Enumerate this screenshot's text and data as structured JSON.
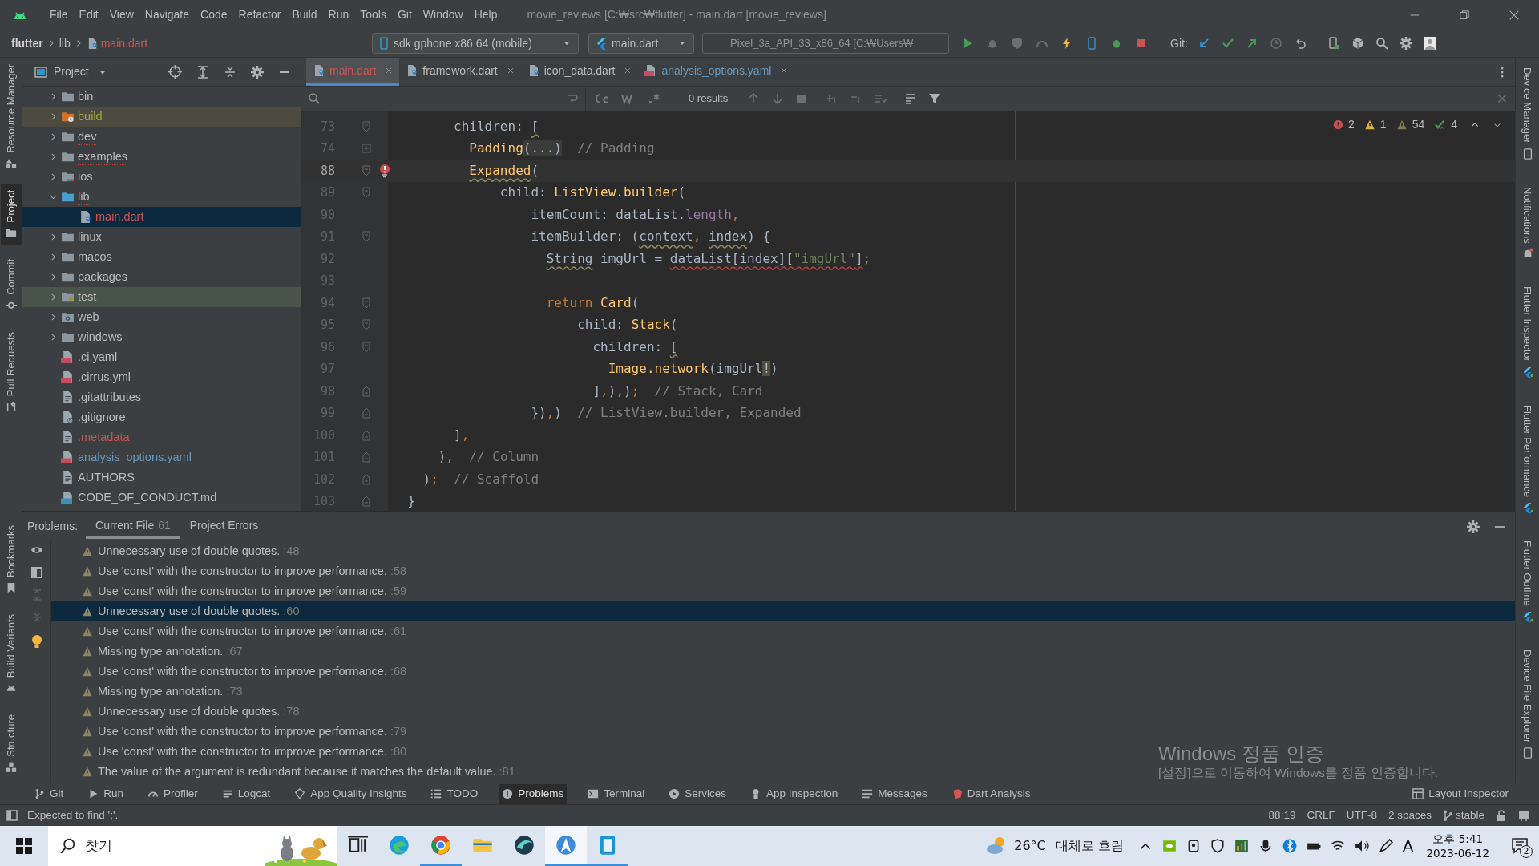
{
  "window": {
    "title": "movie_reviews [C:₩src₩flutter] - main.dart [movie_reviews]"
  },
  "menu": [
    "File",
    "Edit",
    "View",
    "Navigate",
    "Code",
    "Refactor",
    "Build",
    "Run",
    "Tools",
    "Git",
    "Window",
    "Help"
  ],
  "breadcrumbs": [
    {
      "label": "flutter",
      "kind": "project"
    },
    {
      "label": "lib",
      "kind": "folder"
    },
    {
      "label": "main.dart",
      "kind": "dart-file"
    }
  ],
  "run_toolbar": {
    "device": "sdk gphone x86 64 (mobile)",
    "configuration": "main.dart",
    "emulator": "Pixel_3a_API_33_x86_64 [C:₩Users₩",
    "git_label": "Git:"
  },
  "left_strip": [
    {
      "label": "Resource Manager",
      "kind": "resources",
      "selected": false
    },
    {
      "label": "Project",
      "kind": "project",
      "selected": true
    },
    {
      "label": "Commit",
      "kind": "commit",
      "selected": false
    },
    {
      "label": "Pull Requests",
      "kind": "pull",
      "selected": false
    }
  ],
  "left_strip_bottom": [
    {
      "label": "Bookmarks",
      "kind": "bookmark",
      "selected": false
    },
    {
      "label": "Build Variants",
      "kind": "android",
      "selected": false
    },
    {
      "label": "Structure",
      "kind": "structure",
      "selected": false
    }
  ],
  "right_strip": [
    {
      "label": "Device Manager",
      "kind": "device"
    },
    {
      "label": "Notifications",
      "kind": "bell"
    },
    {
      "label": "Flutter Inspector",
      "kind": "flutter"
    },
    {
      "label": "Flutter Performance",
      "kind": "flutter"
    },
    {
      "label": "Flutter Outline",
      "kind": "flutter"
    },
    {
      "label": "Device File Explorer",
      "kind": "device"
    }
  ],
  "project_panel": {
    "title": "Project",
    "tree": [
      {
        "label": "bin",
        "kind": "folder",
        "expanded": false,
        "selected": false,
        "has_errors": false,
        "color": "#bbbbbb"
      },
      {
        "label": "build",
        "kind": "build-folder",
        "expanded": false,
        "selected": false,
        "has_errors": false,
        "color": "#a8a840"
      },
      {
        "label": "dev",
        "kind": "folder",
        "expanded": false,
        "selected": false,
        "has_errors": true,
        "color": "#bbbbbb"
      },
      {
        "label": "examples",
        "kind": "folder",
        "expanded": false,
        "selected": false,
        "has_errors": true,
        "color": "#bbbbbb"
      },
      {
        "label": "ios",
        "kind": "ios-folder",
        "expanded": false,
        "selected": false,
        "has_errors": false,
        "color": "#bbbbbb"
      },
      {
        "label": "lib",
        "kind": "source-folder",
        "expanded": true,
        "selected": false,
        "has_errors": true,
        "color": "#bbbbbb",
        "children": [
          {
            "label": "main.dart",
            "kind": "dart-file",
            "selected": true,
            "has_errors": true,
            "color": "#d25252"
          }
        ]
      },
      {
        "label": "linux",
        "kind": "folder",
        "expanded": false,
        "selected": false,
        "has_errors": false,
        "color": "#bbbbbb"
      },
      {
        "label": "macos",
        "kind": "folder",
        "expanded": false,
        "selected": false,
        "has_errors": false,
        "color": "#bbbbbb"
      },
      {
        "label": "packages",
        "kind": "folder",
        "expanded": false,
        "selected": false,
        "has_errors": true,
        "color": "#bbbbbb"
      },
      {
        "label": "test",
        "kind": "test-folder",
        "expanded": false,
        "selected": false,
        "has_errors": false,
        "color": "#bbbbbb"
      },
      {
        "label": "web",
        "kind": "web-folder",
        "expanded": false,
        "selected": false,
        "has_errors": false,
        "color": "#bbbbbb"
      },
      {
        "label": "windows",
        "kind": "folder",
        "expanded": false,
        "selected": false,
        "has_errors": false,
        "color": "#bbbbbb"
      },
      {
        "label": ".ci.yaml",
        "kind": "yaml-file",
        "selected": false,
        "has_errors": false,
        "color": "#bbbbbb"
      },
      {
        "label": ".cirrus.yml",
        "kind": "yaml-file",
        "selected": false,
        "has_errors": false,
        "color": "#bbbbbb"
      },
      {
        "label": ".gitattributes",
        "kind": "text-file",
        "selected": false,
        "has_errors": false,
        "color": "#bbbbbb"
      },
      {
        "label": ".gitignore",
        "kind": "ignore-file",
        "selected": false,
        "has_errors": false,
        "color": "#bbbbbb"
      },
      {
        "label": ".metadata",
        "kind": "text-file",
        "selected": false,
        "has_errors": false,
        "color": "#c75450"
      },
      {
        "label": "analysis_options.yaml",
        "kind": "yaml-file",
        "selected": false,
        "has_errors": false,
        "color": "#6897bb"
      },
      {
        "label": "AUTHORS",
        "kind": "text-file",
        "selected": false,
        "has_errors": false,
        "color": "#bbbbbb"
      },
      {
        "label": "CODE_OF_CONDUCT.md",
        "kind": "md-file",
        "selected": false,
        "has_errors": false,
        "color": "#bbbbbb"
      }
    ]
  },
  "editor_tabs": [
    {
      "label": "main.dart",
      "kind": "dart-file",
      "selected": true,
      "color": "#d25252"
    },
    {
      "label": "framework.dart",
      "kind": "dart-file",
      "selected": false,
      "color": "#bbbbbb"
    },
    {
      "label": "icon_data.dart",
      "kind": "dart-file",
      "selected": false,
      "color": "#bbbbbb"
    },
    {
      "label": "analysis_options.yaml",
      "kind": "yaml-file",
      "selected": false,
      "color": "#6897bb"
    }
  ],
  "search_bar": {
    "result": "0 results"
  },
  "inspections": {
    "errors": "2",
    "warnings": "1",
    "weak_warnings": "54",
    "typos": "4"
  },
  "code_lines": [
    {
      "number": "73",
      "kind": "fold-start",
      "current": false,
      "error_marker": false,
      "tokens": [
        {
          "kind": "plain",
          "text": "        children: "
        },
        {
          "kind": "plain",
          "text": "[",
          "warning": true
        }
      ]
    },
    {
      "number": "74",
      "kind": "folded",
      "current": false,
      "error_marker": false,
      "tokens": [
        {
          "kind": "call",
          "text": "          Padding"
        },
        {
          "kind": "folded",
          "text": "(...)"
        },
        {
          "kind": "comment",
          "text": "  // Padding"
        }
      ]
    },
    {
      "number": "88",
      "kind": "fold-start",
      "current": true,
      "error_marker": true,
      "tokens": [
        {
          "kind": "call",
          "text": "          Expanded",
          "warning": true
        },
        {
          "kind": "plain",
          "text": "("
        }
      ]
    },
    {
      "number": "89",
      "kind": "fold-start",
      "current": false,
      "error_marker": false,
      "tokens": [
        {
          "kind": "plain",
          "text": "              child: "
        },
        {
          "kind": "call",
          "text": "ListView.builder"
        },
        {
          "kind": "plain",
          "text": "("
        }
      ]
    },
    {
      "number": "90",
      "kind": "plain",
      "current": false,
      "error_marker": false,
      "tokens": [
        {
          "kind": "plain",
          "text": "                  itemCount: dataList."
        },
        {
          "kind": "field",
          "text": "length"
        },
        {
          "kind": "punct",
          "text": ","
        }
      ]
    },
    {
      "number": "91",
      "kind": "fold-start",
      "current": false,
      "error_marker": false,
      "tokens": [
        {
          "kind": "plain",
          "text": "                  itemBuilder: ("
        },
        {
          "kind": "plain",
          "text": "context",
          "warning": true
        },
        {
          "kind": "punct",
          "text": ", "
        },
        {
          "kind": "plain",
          "text": "index",
          "warning": true
        },
        {
          "kind": "plain",
          "text": ") {"
        }
      ]
    },
    {
      "number": "92",
      "kind": "plain",
      "current": false,
      "error_marker": false,
      "tokens": [
        {
          "kind": "plain",
          "text": "                    String",
          "warning": true
        },
        {
          "kind": "plain",
          "text": " imgUrl = "
        },
        {
          "kind": "plain",
          "text": "dataList[index][",
          "error": true
        },
        {
          "kind": "string",
          "text": "\"imgUrl\"",
          "error": true
        },
        {
          "kind": "plain",
          "text": "]",
          "error": true
        },
        {
          "kind": "punct",
          "text": ";"
        }
      ]
    },
    {
      "number": "93",
      "kind": "plain",
      "current": false,
      "error_marker": false
    },
    {
      "number": "94",
      "kind": "fold-start",
      "current": false,
      "error_marker": false,
      "tokens": [
        {
          "kind": "keyword",
          "text": "                    return "
        },
        {
          "kind": "call",
          "text": "Card"
        },
        {
          "kind": "plain",
          "text": "("
        }
      ]
    },
    {
      "number": "95",
      "kind": "fold-start",
      "current": false,
      "error_marker": false,
      "tokens": [
        {
          "kind": "plain",
          "text": "                        child: "
        },
        {
          "kind": "call",
          "text": "Stack"
        },
        {
          "kind": "plain",
          "text": "("
        }
      ]
    },
    {
      "number": "96",
      "kind": "fold-start",
      "current": false,
      "error_marker": false,
      "tokens": [
        {
          "kind": "plain",
          "text": "                          children: "
        },
        {
          "kind": "plain",
          "text": "[",
          "warning": true
        }
      ]
    },
    {
      "number": "97",
      "kind": "plain",
      "current": false,
      "error_marker": false,
      "tokens": [
        {
          "kind": "call",
          "text": "                            Image.network"
        },
        {
          "kind": "plain",
          "text": "(imgUrl"
        },
        {
          "kind": "highlight",
          "text": "!"
        },
        {
          "kind": "plain",
          "text": ")"
        }
      ]
    },
    {
      "number": "98",
      "kind": "fold-end",
      "current": false,
      "error_marker": false,
      "tokens": [
        {
          "kind": "plain",
          "text": "                          ]"
        },
        {
          "kind": "punct",
          "text": ","
        },
        {
          "kind": "plain",
          "text": ")"
        },
        {
          "kind": "punct",
          "text": ","
        },
        {
          "kind": "plain",
          "text": ")"
        },
        {
          "kind": "punct",
          "text": ";"
        },
        {
          "kind": "comment",
          "text": "  // Stack, Card"
        }
      ]
    },
    {
      "number": "99",
      "kind": "fold-end",
      "current": false,
      "error_marker": false,
      "tokens": [
        {
          "kind": "plain",
          "text": "                  })"
        },
        {
          "kind": "punct",
          "text": ","
        },
        {
          "kind": "plain",
          "text": ")"
        },
        {
          "kind": "comment",
          "text": "  // ListView.builder, Expanded"
        }
      ]
    },
    {
      "number": "100",
      "kind": "fold-end",
      "current": false,
      "error_marker": false,
      "tokens": [
        {
          "kind": "plain",
          "text": "        ]"
        },
        {
          "kind": "punct",
          "text": ","
        }
      ]
    },
    {
      "number": "101",
      "kind": "fold-end",
      "current": false,
      "error_marker": false,
      "tokens": [
        {
          "kind": "plain",
          "text": "      )"
        },
        {
          "kind": "punct",
          "text": ","
        },
        {
          "kind": "comment",
          "text": "  // Column"
        }
      ]
    },
    {
      "number": "102",
      "kind": "fold-end",
      "current": false,
      "error_marker": false,
      "tokens": [
        {
          "kind": "plain",
          "text": "    )"
        },
        {
          "kind": "punct",
          "text": ";"
        },
        {
          "kind": "comment",
          "text": "  // Scaffold"
        }
      ]
    },
    {
      "number": "103",
      "kind": "fold-end",
      "current": false,
      "error_marker": false,
      "tokens": [
        {
          "kind": "plain",
          "text": "  }"
        }
      ]
    }
  ],
  "problems": {
    "title": "Problems:",
    "tabs": [
      {
        "label": "Current File",
        "count": "61",
        "selected": true
      },
      {
        "label": "Project Errors",
        "selected": false
      }
    ],
    "rows": [
      {
        "message": "Unnecessary use of double quotes.",
        "line": ":48",
        "selected": false
      },
      {
        "message": "Use 'const' with the constructor to improve performance.",
        "line": ":58",
        "selected": false
      },
      {
        "message": "Use 'const' with the constructor to improve performance.",
        "line": ":59",
        "selected": false
      },
      {
        "message": "Unnecessary use of double quotes.",
        "line": ":60",
        "selected": true
      },
      {
        "message": "Use 'const' with the constructor to improve performance.",
        "line": ":61",
        "selected": false
      },
      {
        "message": "Missing type annotation.",
        "line": ":67",
        "selected": false
      },
      {
        "message": "Use 'const' with the constructor to improve performance.",
        "line": ":68",
        "selected": false
      },
      {
        "message": "Missing type annotation.",
        "line": ":73",
        "selected": false
      },
      {
        "message": "Unnecessary use of double quotes.",
        "line": ":78",
        "selected": false
      },
      {
        "message": "Use 'const' with the constructor to improve performance.",
        "line": ":79",
        "selected": false
      },
      {
        "message": "Use 'const' with the constructor to improve performance.",
        "line": ":80",
        "selected": false
      },
      {
        "message": "The value of the argument is redundant because it matches the default value.",
        "line": ":81",
        "selected": false
      }
    ]
  },
  "tool_windows": [
    {
      "label": "Git",
      "kind": "git",
      "selected": false
    },
    {
      "label": "Run",
      "kind": "run",
      "selected": false
    },
    {
      "label": "Profiler",
      "kind": "profiler",
      "selected": false
    },
    {
      "label": "Logcat",
      "kind": "logcat",
      "selected": false
    },
    {
      "label": "App Quality Insights",
      "kind": "quality",
      "selected": false
    },
    {
      "label": "TODO",
      "kind": "todo",
      "selected": false
    },
    {
      "label": "Problems",
      "kind": "problems",
      "selected": true
    },
    {
      "label": "Terminal",
      "kind": "terminal",
      "selected": false
    },
    {
      "label": "Services",
      "kind": "services",
      "selected": false
    },
    {
      "label": "App Inspection",
      "kind": "inspection",
      "selected": false
    },
    {
      "label": "Messages",
      "kind": "messages",
      "selected": false
    },
    {
      "label": "Dart Analysis",
      "kind": "dart",
      "selected": false
    }
  ],
  "layout_inspector": "Layout Inspector",
  "status_bar": {
    "message": "Expected to find ';'.",
    "position": "88:19",
    "line_separator": "CRLF",
    "encoding": "UTF-8",
    "indent": "2 spaces",
    "channel": "stable"
  },
  "activation_notice": {
    "title": "Windows 정품 인증",
    "text": "[설정]으로 이동하여 Windows를 정품 인증합니다."
  },
  "taskbar": {
    "search": "찾기",
    "apps": [
      {
        "kind": "task-view",
        "selected": false,
        "running": false
      },
      {
        "kind": "edge",
        "selected": false,
        "running": false
      },
      {
        "kind": "chrome",
        "selected": false,
        "running": true
      },
      {
        "kind": "explorer",
        "selected": false,
        "running": false
      },
      {
        "kind": "app",
        "selected": false,
        "running": false
      },
      {
        "kind": "android-studio",
        "selected": true,
        "running": true
      },
      {
        "kind": "emulator",
        "selected": false,
        "running": true
      }
    ],
    "temperature": "26°C",
    "weather": "대체로 흐림",
    "input_mode": "A",
    "time": "오후 5:41",
    "date": "2023-06-12",
    "notifications": "2"
  }
}
